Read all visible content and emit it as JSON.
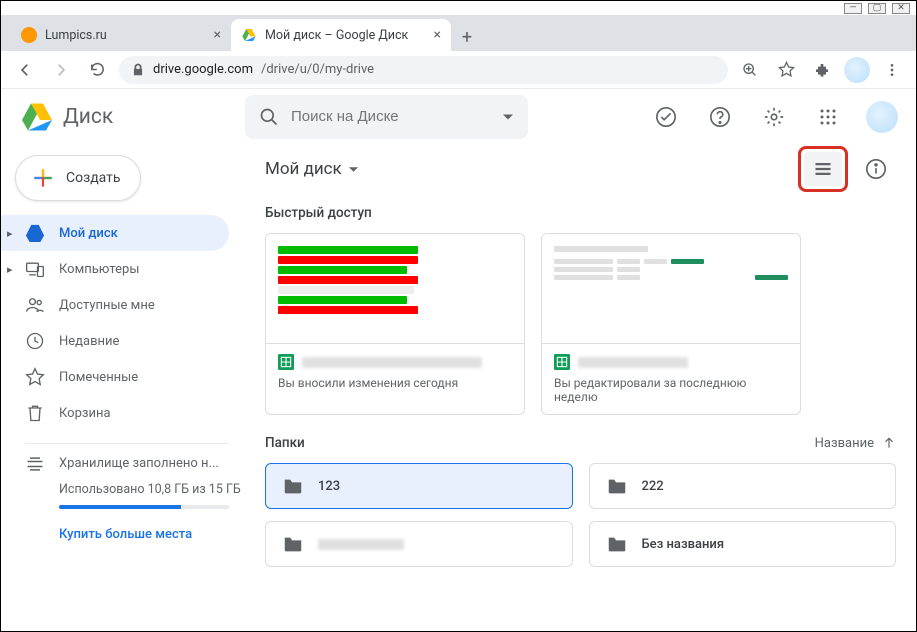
{
  "browser": {
    "tabs": [
      {
        "title": "Lumpics.ru"
      },
      {
        "title": "Мой диск – Google Диск"
      }
    ],
    "url_domain": "drive.google.com",
    "url_path": "/drive/u/0/my-drive"
  },
  "app": {
    "product_name": "Диск",
    "search_placeholder": "Поиск на Диске"
  },
  "sidebar": {
    "create_label": "Создать",
    "items": [
      {
        "label": "Мой диск",
        "icon": "drive"
      },
      {
        "label": "Компьютеры",
        "icon": "devices"
      },
      {
        "label": "Доступные мне",
        "icon": "shared"
      },
      {
        "label": "Недавние",
        "icon": "recent"
      },
      {
        "label": "Помеченные",
        "icon": "star"
      },
      {
        "label": "Корзина",
        "icon": "trash"
      }
    ],
    "storage": {
      "title": "Хранилище заполнено н...",
      "used": "Использовано 10,8 ГБ из 15 ГБ",
      "percent": 72,
      "buy": "Купить больше места"
    }
  },
  "main": {
    "breadcrumb": "Мой диск",
    "quick_label": "Быстрый доступ",
    "quick": [
      {
        "subtitle": "Вы вносили изменения сегодня"
      },
      {
        "subtitle": "Вы редактировали за последнюю неделю"
      }
    ],
    "folders_label": "Папки",
    "sort_label": "Название",
    "folders": [
      {
        "name": "123",
        "selected": true
      },
      {
        "name": "222"
      },
      {
        "name": "",
        "blurred": true
      },
      {
        "name": "Без названия"
      }
    ]
  }
}
